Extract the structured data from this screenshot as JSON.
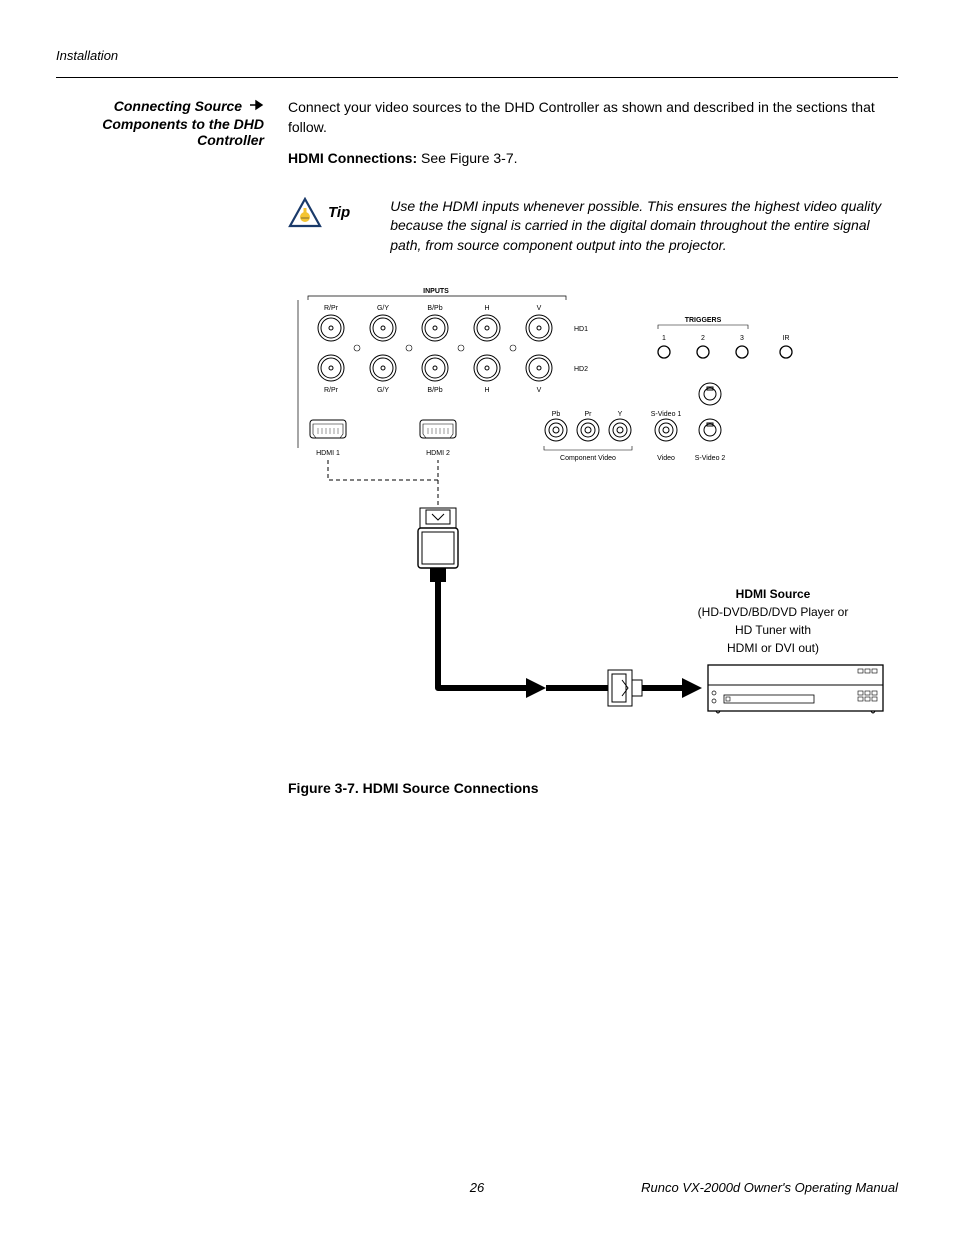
{
  "header": {
    "running": "Installation"
  },
  "sidebar": {
    "title_line1": "Connecting Source",
    "title_line2": "Components to the DHD",
    "title_line3": "Controller"
  },
  "main": {
    "intro": "Connect your video sources to the DHD Controller as shown and described in the sections that follow.",
    "hdmi_label": "HDMI Connections:",
    "hdmi_text": " See Figure 3-7."
  },
  "tip": {
    "label": "Tip",
    "text": "Use the HDMI inputs whenever possible. This ensures the highest video quality because the signal is carried in the digital domain throughout the entire signal path, from source component output into the projector."
  },
  "figure": {
    "caption": "Figure 3-7. HDMI Source Connections",
    "inputs_label": "INPUTS",
    "hd1_row": {
      "ports": [
        "R/Pr",
        "G/Y",
        "B/Pb",
        "H",
        "V"
      ],
      "right_label": "HD1"
    },
    "hd2_row": {
      "ports": [
        "R/Pr",
        "G/Y",
        "B/Pb",
        "H",
        "V"
      ],
      "right_label": "HD2"
    },
    "comp_row": {
      "ports_top": [
        "Pb",
        "Pr",
        "Y",
        "S-Video 1"
      ],
      "groups": [
        "Component Video",
        "Video",
        "S-Video 2"
      ]
    },
    "triggers": {
      "label": "TRIGGERS",
      "nums": [
        "1",
        "2",
        "3"
      ],
      "ir": "IR"
    },
    "hdmi_ports": [
      "HDMI 1",
      "HDMI 2"
    ],
    "source_box": {
      "title": "HDMI Source",
      "line1": "(HD-DVD/BD/DVD Player or",
      "line2": "HD Tuner with",
      "line3": "HDMI or DVI out)"
    }
  },
  "footer": {
    "page": "26",
    "manual": "Runco VX-2000d Owner's Operating Manual"
  }
}
